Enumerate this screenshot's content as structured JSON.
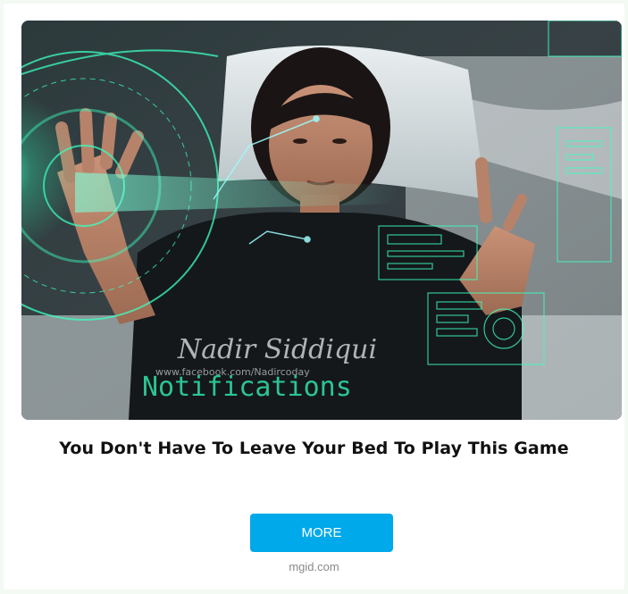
{
  "ad": {
    "image": {
      "alt": "Young man lying in bed interacting with holographic interface",
      "overlay_text": "Notifications",
      "watermark_signature": "Nadir Siddiqui",
      "watermark_url": "www.facebook.com/Nadircoday"
    },
    "headline": "You Don't Have To Leave Your Bed To Play This Game",
    "cta_label": "MORE",
    "source_domain": "mgid.com"
  },
  "colors": {
    "page_background": "#f3f9f3",
    "card_background": "#ffffff",
    "cta_background": "#00a9ea",
    "cta_text": "#ffffff",
    "headline_text": "#111111",
    "source_text": "#8a8a8a",
    "hologram": "#3dffc0"
  }
}
